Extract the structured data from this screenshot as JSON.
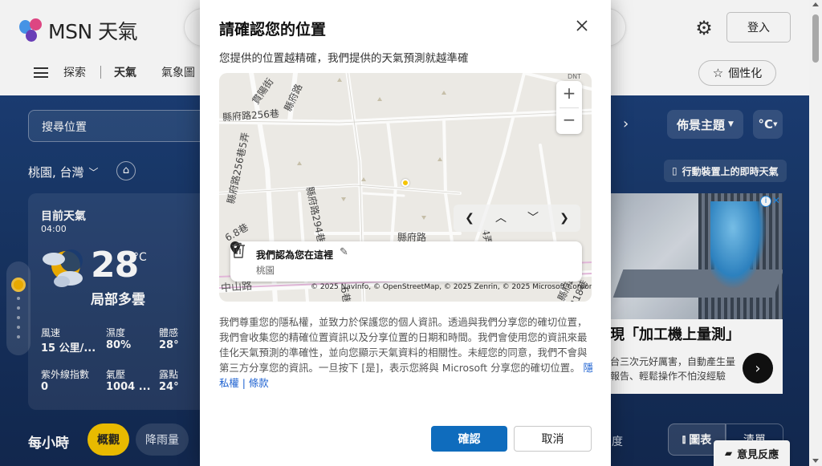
{
  "app": {
    "logo_text": "MSN 天氣"
  },
  "header": {
    "login_label": "登入",
    "nav": [
      "探索",
      "天氣",
      "氣象圖"
    ],
    "personalize_label": "個性化"
  },
  "weather": {
    "search_placeholder": "搜尋位置",
    "location": "桃園, 台灣",
    "current_title": "目前天氣",
    "current_time": "04:00",
    "temperature": "28",
    "temp_unit": "°C",
    "condition": "局部多雲",
    "stats": [
      {
        "label": "風速",
        "value": "15 公里/..."
      },
      {
        "label": "濕度",
        "value": "80%"
      },
      {
        "label": "體感",
        "value": "28°"
      },
      {
        "label": "紫外線指數",
        "value": "0"
      },
      {
        "label": "氣壓",
        "value": "1004 ..."
      },
      {
        "label": "露點",
        "value": "24°"
      }
    ],
    "hourly_title": "每小時",
    "tabs": [
      "概觀",
      "降雨量"
    ],
    "theme_label": "佈景主題",
    "unit_label": "°C",
    "mobile_label": "行動裝置上的即時天氣",
    "chart_label": "圖表",
    "list_label": "清單",
    "deg_stub": "度"
  },
  "ad": {
    "headline": "現「加工機上量測」",
    "sub_line1": "台三次元好厲害，自動產生量",
    "sub_line2": "報告、輕鬆操作不怕沒經驗"
  },
  "feedback_label": "意見反應",
  "dialog": {
    "title": "請確認您的位置",
    "subtitle": "您提供的位置越精確，我們提供的天氣預測就越準確",
    "map": {
      "street_labels": [
        "縣府路256巷",
        "貫陽街",
        "縣府路",
        "縣府路256巷5弄",
        "縣府路294巷",
        "縣府路",
        "中山路",
        "縣府路418巷",
        "4弄",
        "6巷",
        "6.8巷"
      ],
      "attribution": "© 2025 NavInfo, © OpenStreetMap, © 2025 Zenrin, © 2025 Microsoft Corporation",
      "loc_card_title": "我們認為您在這裡",
      "loc_card_name": "桃園",
      "dnt_label": "DNT"
    },
    "body_text": "我們尊重您的隱私權，並致力於保護您的個人資訊。透過與我們分享您的確切位置，我們會收集您的精確位置資訊以及分享位置的日期和時間。我們會使用您的資訊來最佳化天氣預測的準確性，並向您顯示天氣資料的相關性。未經您的同意，我們不會與第三方分享您的資訊。一旦按下 [是]，表示您將與 Microsoft 分享您的確切位置。",
    "privacy_link": "隱私權 | 條款",
    "confirm_label": "確認",
    "cancel_label": "取消"
  },
  "colors": {
    "accent": "#0f6cbd",
    "weather_bg": "#1c3f76",
    "pill_active": "#f5c400"
  }
}
